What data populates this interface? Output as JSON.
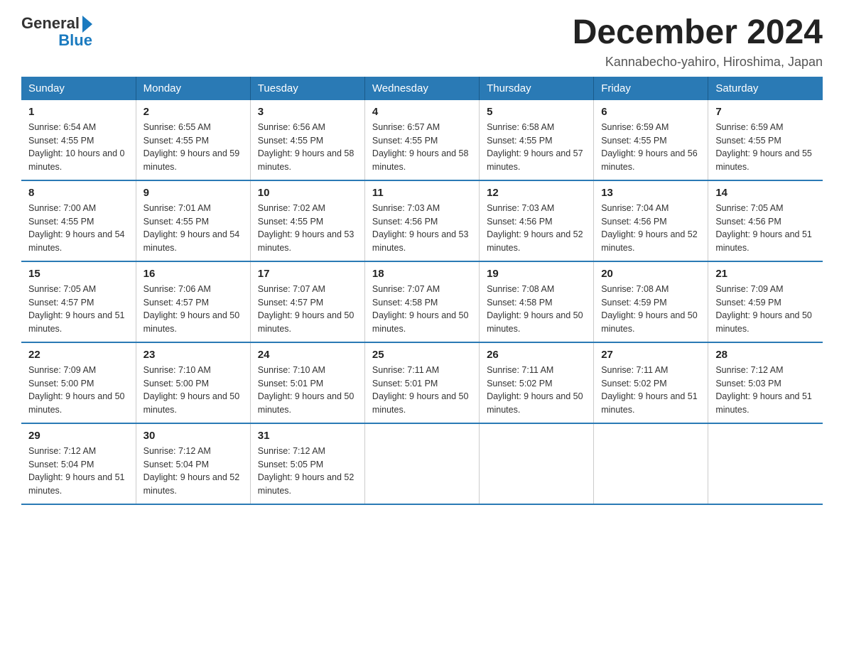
{
  "header": {
    "logo_general": "General",
    "logo_blue": "Blue",
    "month_title": "December 2024",
    "location": "Kannabecho-yahiro, Hiroshima, Japan"
  },
  "days_of_week": [
    "Sunday",
    "Monday",
    "Tuesday",
    "Wednesday",
    "Thursday",
    "Friday",
    "Saturday"
  ],
  "weeks": [
    [
      {
        "day": "1",
        "sunrise": "6:54 AM",
        "sunset": "4:55 PM",
        "daylight": "10 hours and 0 minutes."
      },
      {
        "day": "2",
        "sunrise": "6:55 AM",
        "sunset": "4:55 PM",
        "daylight": "9 hours and 59 minutes."
      },
      {
        "day": "3",
        "sunrise": "6:56 AM",
        "sunset": "4:55 PM",
        "daylight": "9 hours and 58 minutes."
      },
      {
        "day": "4",
        "sunrise": "6:57 AM",
        "sunset": "4:55 PM",
        "daylight": "9 hours and 58 minutes."
      },
      {
        "day": "5",
        "sunrise": "6:58 AM",
        "sunset": "4:55 PM",
        "daylight": "9 hours and 57 minutes."
      },
      {
        "day": "6",
        "sunrise": "6:59 AM",
        "sunset": "4:55 PM",
        "daylight": "9 hours and 56 minutes."
      },
      {
        "day": "7",
        "sunrise": "6:59 AM",
        "sunset": "4:55 PM",
        "daylight": "9 hours and 55 minutes."
      }
    ],
    [
      {
        "day": "8",
        "sunrise": "7:00 AM",
        "sunset": "4:55 PM",
        "daylight": "9 hours and 54 minutes."
      },
      {
        "day": "9",
        "sunrise": "7:01 AM",
        "sunset": "4:55 PM",
        "daylight": "9 hours and 54 minutes."
      },
      {
        "day": "10",
        "sunrise": "7:02 AM",
        "sunset": "4:55 PM",
        "daylight": "9 hours and 53 minutes."
      },
      {
        "day": "11",
        "sunrise": "7:03 AM",
        "sunset": "4:56 PM",
        "daylight": "9 hours and 53 minutes."
      },
      {
        "day": "12",
        "sunrise": "7:03 AM",
        "sunset": "4:56 PM",
        "daylight": "9 hours and 52 minutes."
      },
      {
        "day": "13",
        "sunrise": "7:04 AM",
        "sunset": "4:56 PM",
        "daylight": "9 hours and 52 minutes."
      },
      {
        "day": "14",
        "sunrise": "7:05 AM",
        "sunset": "4:56 PM",
        "daylight": "9 hours and 51 minutes."
      }
    ],
    [
      {
        "day": "15",
        "sunrise": "7:05 AM",
        "sunset": "4:57 PM",
        "daylight": "9 hours and 51 minutes."
      },
      {
        "day": "16",
        "sunrise": "7:06 AM",
        "sunset": "4:57 PM",
        "daylight": "9 hours and 50 minutes."
      },
      {
        "day": "17",
        "sunrise": "7:07 AM",
        "sunset": "4:57 PM",
        "daylight": "9 hours and 50 minutes."
      },
      {
        "day": "18",
        "sunrise": "7:07 AM",
        "sunset": "4:58 PM",
        "daylight": "9 hours and 50 minutes."
      },
      {
        "day": "19",
        "sunrise": "7:08 AM",
        "sunset": "4:58 PM",
        "daylight": "9 hours and 50 minutes."
      },
      {
        "day": "20",
        "sunrise": "7:08 AM",
        "sunset": "4:59 PM",
        "daylight": "9 hours and 50 minutes."
      },
      {
        "day": "21",
        "sunrise": "7:09 AM",
        "sunset": "4:59 PM",
        "daylight": "9 hours and 50 minutes."
      }
    ],
    [
      {
        "day": "22",
        "sunrise": "7:09 AM",
        "sunset": "5:00 PM",
        "daylight": "9 hours and 50 minutes."
      },
      {
        "day": "23",
        "sunrise": "7:10 AM",
        "sunset": "5:00 PM",
        "daylight": "9 hours and 50 minutes."
      },
      {
        "day": "24",
        "sunrise": "7:10 AM",
        "sunset": "5:01 PM",
        "daylight": "9 hours and 50 minutes."
      },
      {
        "day": "25",
        "sunrise": "7:11 AM",
        "sunset": "5:01 PM",
        "daylight": "9 hours and 50 minutes."
      },
      {
        "day": "26",
        "sunrise": "7:11 AM",
        "sunset": "5:02 PM",
        "daylight": "9 hours and 50 minutes."
      },
      {
        "day": "27",
        "sunrise": "7:11 AM",
        "sunset": "5:02 PM",
        "daylight": "9 hours and 51 minutes."
      },
      {
        "day": "28",
        "sunrise": "7:12 AM",
        "sunset": "5:03 PM",
        "daylight": "9 hours and 51 minutes."
      }
    ],
    [
      {
        "day": "29",
        "sunrise": "7:12 AM",
        "sunset": "5:04 PM",
        "daylight": "9 hours and 51 minutes."
      },
      {
        "day": "30",
        "sunrise": "7:12 AM",
        "sunset": "5:04 PM",
        "daylight": "9 hours and 52 minutes."
      },
      {
        "day": "31",
        "sunrise": "7:12 AM",
        "sunset": "5:05 PM",
        "daylight": "9 hours and 52 minutes."
      },
      null,
      null,
      null,
      null
    ]
  ]
}
